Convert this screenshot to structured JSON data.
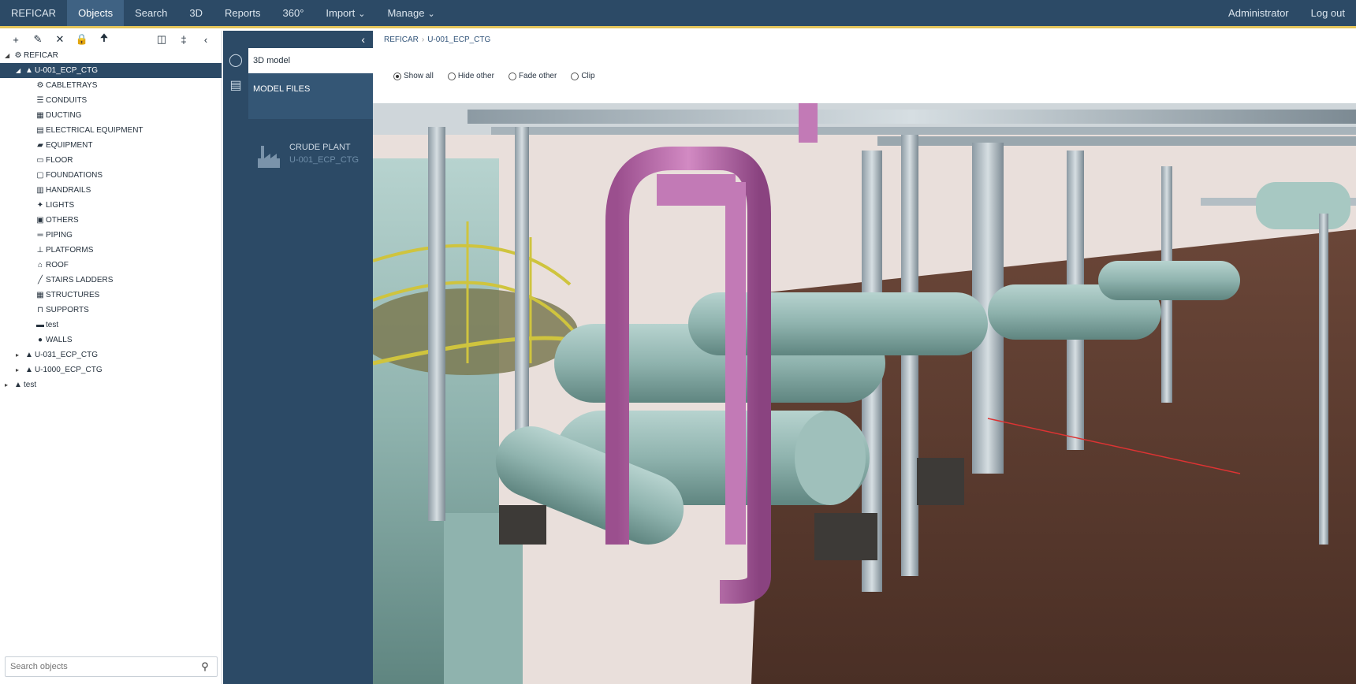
{
  "nav": {
    "items": [
      "REFICAR",
      "Objects",
      "Search",
      "3D",
      "Reports",
      "360°",
      "Import",
      "Manage"
    ],
    "active_index": 1,
    "right": [
      "Administrator",
      "Log out"
    ]
  },
  "toolbar": {
    "icons": [
      "add-icon",
      "edit-icon",
      "delete-icon",
      "lock-icon",
      "move-up-icon",
      "panel-icon",
      "pin-icon",
      "collapse-icon"
    ]
  },
  "tree": {
    "root": "REFICAR",
    "selected": "U-001_ECP_CTG",
    "children": [
      {
        "label": "CABLETRAYS",
        "icon": "gear-icon"
      },
      {
        "label": "CONDUITS",
        "icon": "conduit-icon"
      },
      {
        "label": "DUCTING",
        "icon": "ducting-icon"
      },
      {
        "label": "ELECTRICAL EQUIPMENT",
        "icon": "electrical-icon"
      },
      {
        "label": "EQUIPMENT",
        "icon": "equipment-icon"
      },
      {
        "label": "FLOOR",
        "icon": "floor-icon"
      },
      {
        "label": "FOUNDATIONS",
        "icon": "foundation-icon"
      },
      {
        "label": "HANDRAILS",
        "icon": "handrail-icon"
      },
      {
        "label": "LIGHTS",
        "icon": "light-icon"
      },
      {
        "label": "OTHERS",
        "icon": "others-icon"
      },
      {
        "label": "PIPING",
        "icon": "piping-icon"
      },
      {
        "label": "PLATFORMS",
        "icon": "platform-icon"
      },
      {
        "label": "ROOF",
        "icon": "roof-icon"
      },
      {
        "label": "STAIRS LADDERS",
        "icon": "ladder-icon"
      },
      {
        "label": "STRUCTURES",
        "icon": "structure-icon"
      },
      {
        "label": "SUPPORTS",
        "icon": "support-icon"
      },
      {
        "label": "test",
        "icon": "test-icon"
      },
      {
        "label": "WALLS",
        "icon": "wall-icon"
      }
    ],
    "siblings": [
      "U-031_ECP_CTG",
      "U-1000_ECP_CTG"
    ],
    "other_root": "test"
  },
  "search": {
    "placeholder": "Search objects"
  },
  "panel": {
    "tab_3d": "3D model",
    "tab_files": "MODEL FILES",
    "file_title": "CRUDE PLANT",
    "file_sub": "U-001_ECP_CTG"
  },
  "content": {
    "breadcrumb": [
      "REFICAR",
      "U-001_ECP_CTG"
    ],
    "view_options": [
      "Show all",
      "Hide other",
      "Fade other",
      "Clip"
    ],
    "selected_option": "Show all"
  }
}
